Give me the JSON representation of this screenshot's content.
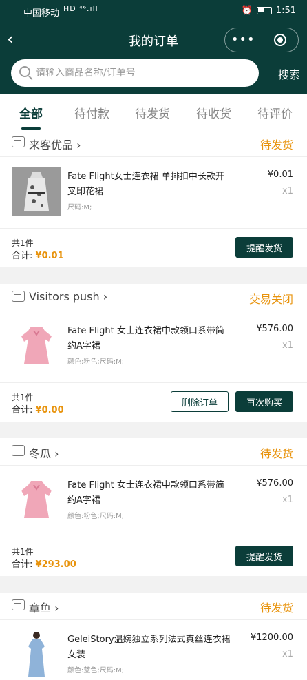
{
  "statusbar": {
    "carrier": "中国移动",
    "signal": "HD ⁴⁶.ıll",
    "time": "1:51"
  },
  "header": {
    "title": "我的订单",
    "back": "‹"
  },
  "search": {
    "placeholder": "请输入商品名称/订单号",
    "button": "搜索"
  },
  "tabs": [
    "全部",
    "待付款",
    "待发货",
    "待收货",
    "待评价"
  ],
  "orders": [
    {
      "shop": "来客优品",
      "status": "待发货",
      "item": {
        "name": "Fate Flight女士连衣裙 单排扣中长款开叉印花裙",
        "spec": "尺码:M;",
        "price": "¥0.01",
        "qty": "x1"
      },
      "count": "共1件",
      "total_label": "合计:",
      "total": "¥0.01",
      "buttons": [
        "提醒发货"
      ]
    },
    {
      "shop": "Visitors push",
      "status": "交易关闭",
      "item": {
        "name": "Fate Flight 女士连衣裙中款领口系带简约A字裙",
        "spec": "颜色:粉色;尺码:M;",
        "price": "¥576.00",
        "qty": "x1"
      },
      "count": "共1件",
      "total_label": "合计:",
      "total": "¥0.00",
      "buttons": [
        "删除订单",
        "再次购买"
      ]
    },
    {
      "shop": "冬瓜",
      "status": "待发货",
      "item": {
        "name": "Fate Flight 女士连衣裙中款领口系带简约A字裙",
        "spec": "颜色:粉色;尺码:M;",
        "price": "¥576.00",
        "qty": "x1"
      },
      "count": "共1件",
      "total_label": "合计:",
      "total": "¥293.00",
      "buttons": [
        "提醒发货"
      ]
    },
    {
      "shop": "章鱼",
      "status": "待发货",
      "item": {
        "name": "GeleiStory温婉独立系列法式真丝连衣裙女装",
        "spec": "颜色:蓝色;尺码:M;",
        "price": "¥1200.00",
        "qty": "x1"
      }
    }
  ],
  "colors": {
    "brand": "#0b3d39",
    "accent": "#e8930c"
  }
}
